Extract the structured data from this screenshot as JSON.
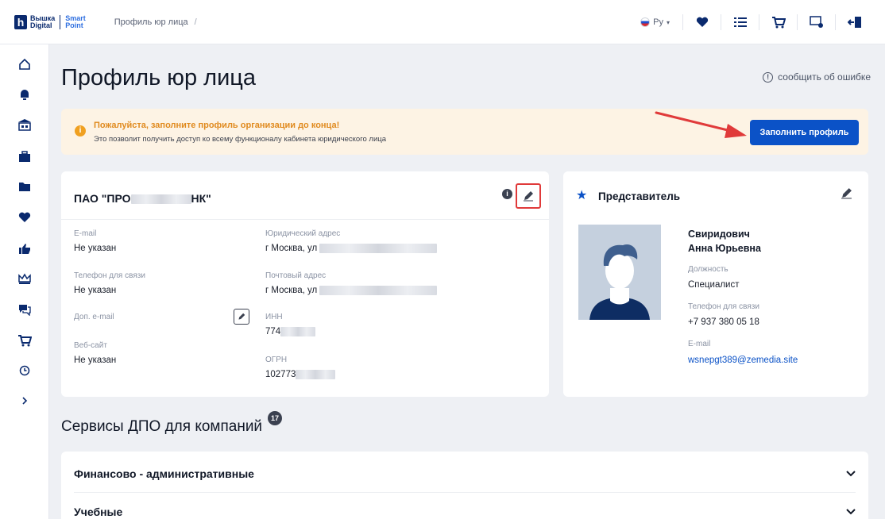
{
  "brand": {
    "mark": "h",
    "line1": "Вышка",
    "line2": "Digital",
    "line3": "Smart",
    "line4": "Point"
  },
  "breadcrumb": {
    "current": "Профиль юр лица",
    "separator": "/"
  },
  "header": {
    "lang": "Ру"
  },
  "page": {
    "title": "Профиль юр лица",
    "report": "сообщить об ошибке"
  },
  "alert": {
    "title": "Пожалуйста, заполните профиль организации до конца!",
    "text": "Это позволит получить доступ ко всему функционалу кабинета юридического лица",
    "button": "Заполнить профиль"
  },
  "org": {
    "name_start": "ПАО \"ПРО",
    "name_end": "НК\"",
    "email_label": "E-mail",
    "email_value": "Не указан",
    "phone_label": "Телефон для связи",
    "phone_value": "Не указан",
    "extra_email_label": "Доп. e-mail",
    "site_label": "Веб-сайт",
    "site_value": "Не указан",
    "legal_address_label": "Юридический адрес",
    "legal_address_value": "г Москва, ул",
    "postal_address_label": "Почтовый адрес",
    "postal_address_value": "г Москва, ул",
    "inn_label": "ИНН",
    "inn_value": "774",
    "ogrn_label": "ОГРН",
    "ogrn_value": "102773"
  },
  "rep": {
    "title": "Представитель",
    "surname": "Свиридович",
    "name": "Анна Юрьевна",
    "position_label": "Должность",
    "position_value": "Специалист",
    "phone_label": "Телефон для связи",
    "phone_value": "+7 937 380 05 18",
    "email_label": "E-mail",
    "email_value": "wsnepgt389@zemedia.site"
  },
  "services": {
    "title": "Сервисы ДПО для компаний",
    "count": "17",
    "groups": [
      "Финансово - административные",
      "Учебные"
    ]
  },
  "colors": {
    "accent": "#0b52c7",
    "navy": "#0a2a6e",
    "alert_bg": "#fdf3e4",
    "alert_title": "#e08a1e",
    "annotation": "#e03a3a"
  },
  "icons": {
    "top": [
      "heart-icon",
      "list-icon",
      "cart-icon",
      "certificate-icon",
      "logout-icon"
    ],
    "sidebar": [
      "home-icon",
      "bell-icon",
      "building-icon",
      "briefcase-icon",
      "folder-icon",
      "heart-icon",
      "thumbs-up-icon",
      "crown-icon",
      "chat-icon",
      "cart-icon",
      "clock-icon",
      "chevron-right-icon"
    ]
  }
}
